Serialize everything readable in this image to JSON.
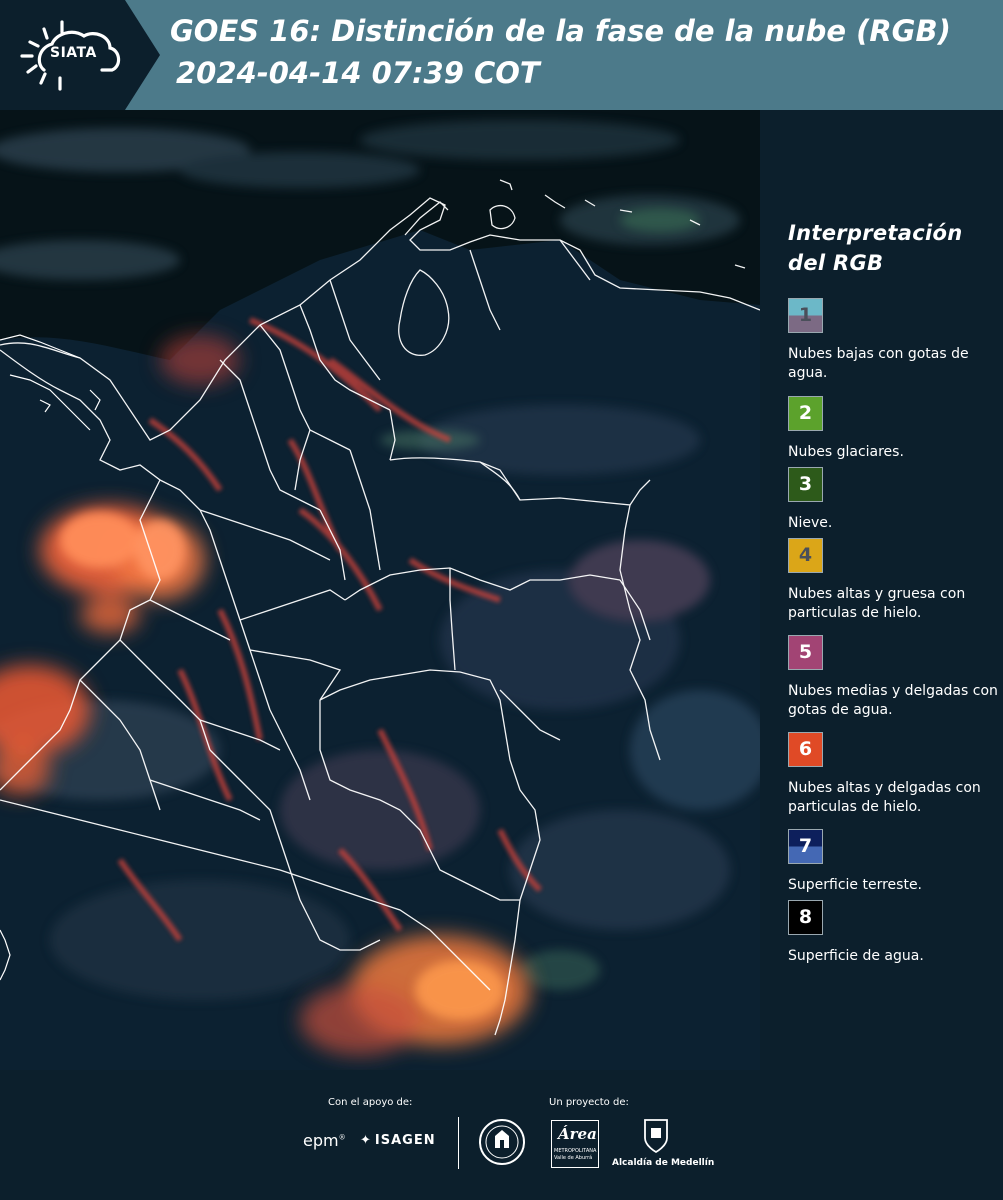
{
  "header": {
    "logo_text": "SIATA",
    "title_line_1": "GOES 16: Distinción de la fase de la nube (RGB)",
    "title_line_2": "2024-04-14 07:39 COT"
  },
  "legend": {
    "title": "Interpretación del RGB",
    "items": [
      {
        "number": "1",
        "label": "Nubes bajas con gotas de agua.",
        "color_top": "#6cb8c8",
        "color_bottom": "#7c6a84",
        "number_color": "#4a4f5a"
      },
      {
        "number": "2",
        "label": "Nubes glaciares.",
        "color_top": "#5ca22c",
        "color_bottom": "#5ca22c",
        "number_color": "#ffffff"
      },
      {
        "number": "3",
        "label": "Nieve.",
        "color_top": "#2d5a1a",
        "color_bottom": "#2d5a1a",
        "number_color": "#ffffff"
      },
      {
        "number": "4",
        "label": "Nubes altas y gruesa con particulas de hielo.",
        "color_top": "#dba618",
        "color_bottom": "#dba618",
        "number_color": "#4a4f5a"
      },
      {
        "number": "5",
        "label": "Nubes medias y delgadas con gotas de agua.",
        "color_top": "#a24474",
        "color_bottom": "#a24474",
        "number_color": "#ffffff"
      },
      {
        "number": "6",
        "label": "Nubes altas y delgadas con particulas de hielo.",
        "color_top": "#e04a26",
        "color_bottom": "#e04a26",
        "number_color": "#ffffff"
      },
      {
        "number": "7",
        "label": "Superficie terreste.",
        "color_top": "#0d1f5c",
        "color_bottom": "#4468b4",
        "number_color": "#ffffff"
      },
      {
        "number": "8",
        "label": "Superficie de agua.",
        "color_top": "#000000",
        "color_bottom": "#000000",
        "number_color": "#ffffff"
      }
    ]
  },
  "footer": {
    "support_caption": "Con el apoyo de:",
    "project_caption": "Un proyecto de:",
    "partners": {
      "epm": "epm",
      "isagen": "ISAGEN",
      "area_metropolitana": "Área",
      "area_subtitle": "METROPOLITANA Valle de Aburrá",
      "alcaldia": "Alcaldía de Medellín"
    }
  },
  "colors": {
    "header_bg": "#4c7a8a",
    "panel_bg": "#0c1f2c",
    "cloud_orange": "#f26a3a",
    "cloud_pink": "#8a5a78",
    "land_dark": "#0f2738",
    "boundary_white": "#ffffff"
  }
}
